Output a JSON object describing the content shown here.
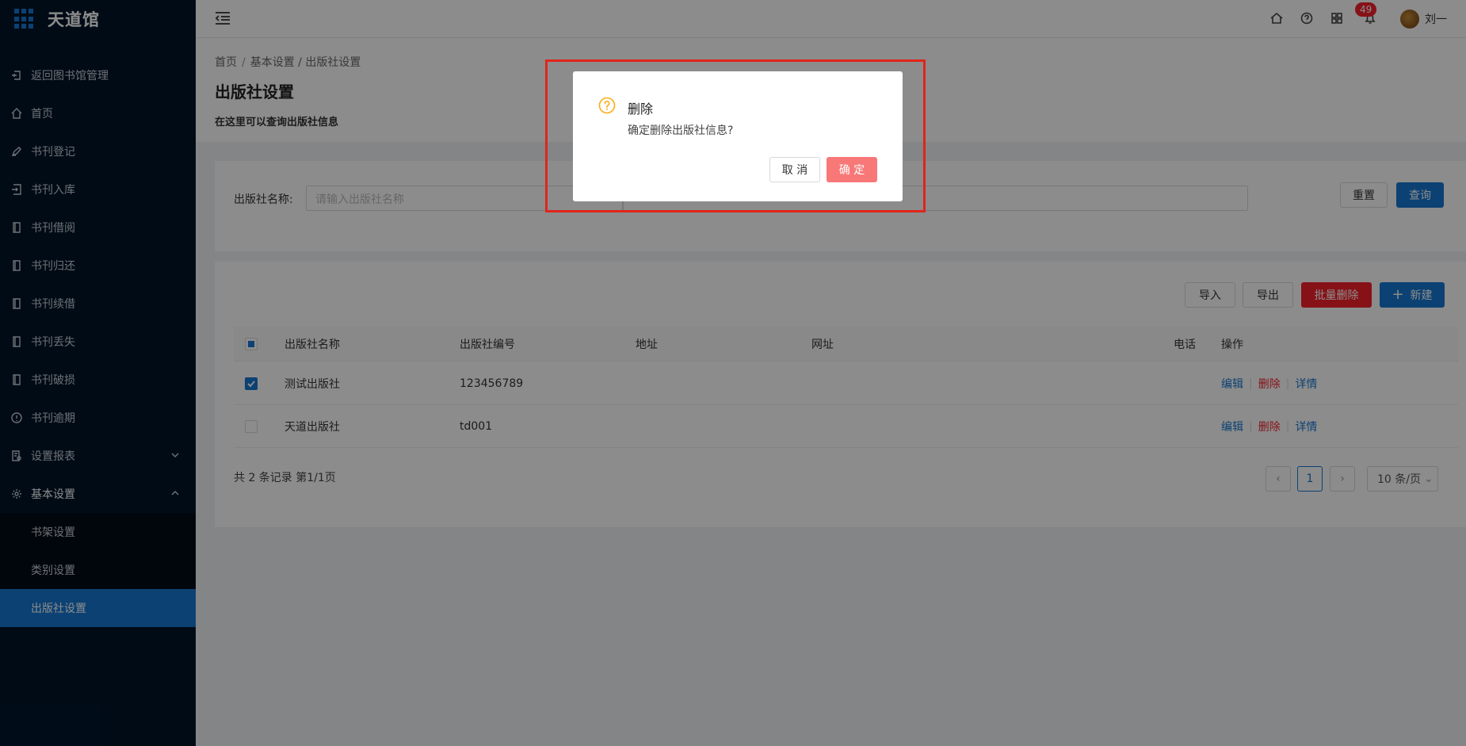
{
  "app": {
    "logo_text": "天道馆"
  },
  "sidebar": {
    "items": [
      {
        "label": "返回图书馆管理",
        "icon": "return-icon"
      },
      {
        "label": "首页",
        "icon": "home-icon"
      },
      {
        "label": "书刊登记",
        "icon": "pen-icon"
      },
      {
        "label": "书刊入库",
        "icon": "import-icon"
      },
      {
        "label": "书刊借阅",
        "icon": "book-icon"
      },
      {
        "label": "书刊归还",
        "icon": "book-icon"
      },
      {
        "label": "书刊续借",
        "icon": "book-icon"
      },
      {
        "label": "书刊丢失",
        "icon": "book-icon"
      },
      {
        "label": "书刊破损",
        "icon": "book-icon"
      },
      {
        "label": "书刊逾期",
        "icon": "info-icon"
      },
      {
        "label": "设置报表",
        "icon": "report-icon"
      },
      {
        "label": "基本设置",
        "icon": "gear-icon"
      }
    ],
    "submenu": [
      {
        "label": "书架设置"
      },
      {
        "label": "类别设置"
      },
      {
        "label": "出版社设置"
      }
    ]
  },
  "header": {
    "notification_count": "49",
    "username": "刘一"
  },
  "breadcrumb": {
    "home": "首页",
    "sep": "/",
    "path": "基本设置 / 出版社设置"
  },
  "page": {
    "title": "出版社设置",
    "description": "在这里可以查询出版社信息"
  },
  "search": {
    "name_label": "出版社名称:",
    "name_placeholder": "请输入出版社名称",
    "reset_label": "重置",
    "query_label": "查询"
  },
  "toolbar": {
    "import_label": "导入",
    "export_label": "导出",
    "batch_delete_label": "批量删除",
    "new_label": "新建"
  },
  "table": {
    "columns": [
      "出版社名称",
      "出版社编号",
      "地址",
      "网址",
      "电话",
      "操作"
    ],
    "rows": [
      {
        "name": "测试出版社",
        "code": "123456789",
        "address": "",
        "website": "",
        "phone": "",
        "checked": true
      },
      {
        "name": "天道出版社",
        "code": "td001",
        "address": "",
        "website": "",
        "phone": "",
        "checked": false
      }
    ],
    "actions": {
      "edit": "编辑",
      "delete": "删除",
      "detail": "详情",
      "sep": "|"
    }
  },
  "pagination": {
    "total_text": "共 2 条记录 第1/1页",
    "current_page": "1",
    "page_size": "10 条/页"
  },
  "modal": {
    "title": "删除",
    "content": "确定删除出版社信息?",
    "cancel_label": "取 消",
    "ok_label": "确 定"
  },
  "colors": {
    "sidebar_bg": "#001529",
    "primary": "#1677d2",
    "danger": "#f5222d",
    "warning_icon": "#faad14",
    "highlight_border": "#e0251c"
  }
}
